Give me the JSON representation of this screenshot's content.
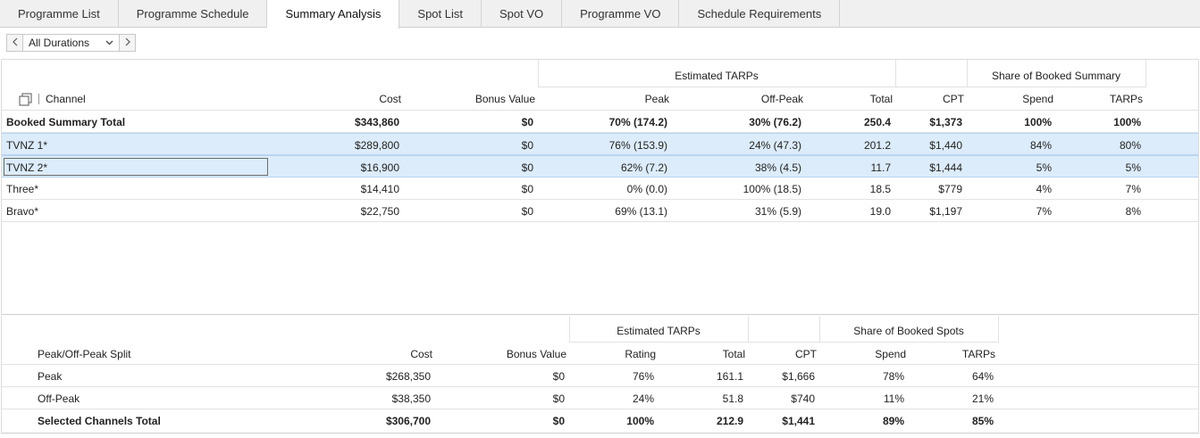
{
  "tabs": [
    {
      "label": "Programme List",
      "active": false
    },
    {
      "label": "Programme Schedule",
      "active": false
    },
    {
      "label": "Summary Analysis",
      "active": true
    },
    {
      "label": "Spot List",
      "active": false
    },
    {
      "label": "Spot VO",
      "active": false
    },
    {
      "label": "Programme VO",
      "active": false
    },
    {
      "label": "Schedule Requirements",
      "active": false
    }
  ],
  "toolbar": {
    "prev_icon": "chevron-left",
    "next_icon": "chevron-right",
    "duration_selected": "All Durations"
  },
  "summary": {
    "group_headers": {
      "estimated_tarps": "Estimated TARPs",
      "share_booked": "Share of Booked Summary"
    },
    "columns": {
      "channel": "Channel",
      "cost": "Cost",
      "bonus": "Bonus Value",
      "peak": "Peak",
      "offpeak": "Off-Peak",
      "total": "Total",
      "cpt": "CPT",
      "spend": "Spend",
      "tarps": "TARPs"
    },
    "total_row": {
      "channel": "Booked Summary Total",
      "cost": "$343,860",
      "bonus": "$0",
      "peak": "70% (174.2)",
      "offpeak": "30% (76.2)",
      "total": "250.4",
      "cpt": "$1,373",
      "spend": "100%",
      "tarps": "100%"
    },
    "rows": [
      {
        "channel": "TVNZ 1*",
        "cost": "$289,800",
        "bonus": "$0",
        "peak": "76% (153.9)",
        "offpeak": "24% (47.3)",
        "total": "201.2",
        "cpt": "$1,440",
        "spend": "84%",
        "tarps": "80%",
        "selected": true
      },
      {
        "channel": "TVNZ 2*",
        "cost": "$16,900",
        "bonus": "$0",
        "peak": "62% (7.2)",
        "offpeak": "38% (4.5)",
        "total": "11.7",
        "cpt": "$1,444",
        "spend": "5%",
        "tarps": "5%",
        "selected": true
      },
      {
        "channel": "Three*",
        "cost": "$14,410",
        "bonus": "$0",
        "peak": "0% (0.0)",
        "offpeak": "100% (18.5)",
        "total": "18.5",
        "cpt": "$779",
        "spend": "4%",
        "tarps": "7%",
        "selected": false
      },
      {
        "channel": "Bravo*",
        "cost": "$22,750",
        "bonus": "$0",
        "peak": "69% (13.1)",
        "offpeak": "31% (5.9)",
        "total": "19.0",
        "cpt": "$1,197",
        "spend": "7%",
        "tarps": "8%",
        "selected": false
      }
    ]
  },
  "split": {
    "group_headers": {
      "estimated_tarps": "Estimated TARPs",
      "share_spots": "Share of Booked Spots"
    },
    "columns": {
      "label": "Peak/Off-Peak Split",
      "cost": "Cost",
      "bonus": "Bonus Value",
      "rating": "Rating",
      "total": "Total",
      "cpt": "CPT",
      "spend": "Spend",
      "tarps": "TARPs"
    },
    "rows": [
      {
        "label": "Peak",
        "cost": "$268,350",
        "bonus": "$0",
        "rating": "76%",
        "total": "161.1",
        "cpt": "$1,666",
        "spend": "78%",
        "tarps": "64%",
        "bold": false
      },
      {
        "label": "Off-Peak",
        "cost": "$38,350",
        "bonus": "$0",
        "rating": "24%",
        "total": "51.8",
        "cpt": "$740",
        "spend": "11%",
        "tarps": "21%",
        "bold": false
      },
      {
        "label": "Selected Channels Total",
        "cost": "$306,700",
        "bonus": "$0",
        "rating": "100%",
        "total": "212.9",
        "cpt": "$1,441",
        "spend": "89%",
        "tarps": "85%",
        "bold": true
      }
    ]
  }
}
